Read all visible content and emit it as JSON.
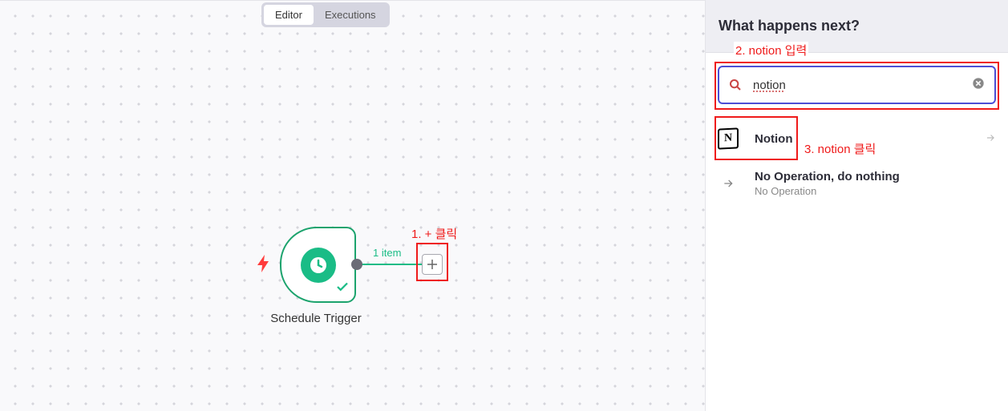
{
  "tabs": {
    "editor": "Editor",
    "executions": "Executions"
  },
  "canvas": {
    "node_label": "Schedule Trigger",
    "item_count": "1 item"
  },
  "annotations": {
    "step1": "1. + 클릭",
    "step2": "2. notion 입력",
    "step3": "3. notion 클릭"
  },
  "sidebar": {
    "title": "What happens next?",
    "search_value": "notion",
    "results": {
      "notion": {
        "label": "Notion",
        "icon_text": "N"
      },
      "noop": {
        "title": "No Operation, do nothing",
        "subtitle": "No Operation"
      }
    }
  }
}
